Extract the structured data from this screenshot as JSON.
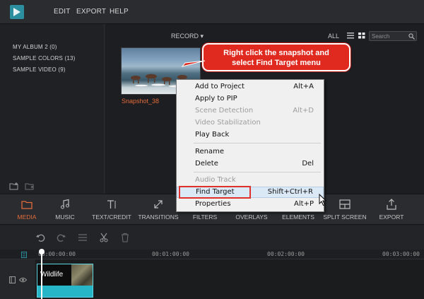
{
  "menu": {
    "items": [
      "EDIT",
      "EXPORT",
      "HELP"
    ]
  },
  "library": {
    "items": [
      "MY ALBUM 2 (0)",
      "SAMPLE COLORS (13)",
      "SAMPLE VIDEO (9)"
    ]
  },
  "media": {
    "record_label": "RECORD ▾",
    "all_label": "ALL",
    "search_placeholder": "Search",
    "thumbnail_label": "Snapshot_38"
  },
  "callout": {
    "line1": "Right click the snapshot and",
    "line2": "select Find Target menu"
  },
  "context_menu": {
    "items": [
      {
        "label": "Add to Project",
        "shortcut": "Alt+A",
        "disabled": false
      },
      {
        "label": "Apply to PIP",
        "shortcut": "",
        "disabled": false
      },
      {
        "label": "Scene Detection",
        "shortcut": "Alt+D",
        "disabled": true
      },
      {
        "label": "Video Stabilization",
        "shortcut": "",
        "disabled": true
      },
      {
        "label": "Play Back",
        "shortcut": "",
        "disabled": false
      },
      {
        "label": "Rename",
        "shortcut": "",
        "disabled": false
      },
      {
        "label": "Delete",
        "shortcut": "Del",
        "disabled": false
      },
      {
        "label": "Audio Track",
        "shortcut": "",
        "disabled": true
      },
      {
        "label": "Find Target",
        "shortcut": "Shift+Ctrl+R",
        "disabled": false
      },
      {
        "label": "Properties",
        "shortcut": "Alt+P",
        "disabled": false
      }
    ]
  },
  "toolbar": {
    "tabs": [
      "MEDIA",
      "MUSIC",
      "TEXT/CREDIT",
      "TRANSITIONS",
      "FILTERS",
      "OVERLAYS",
      "ELEMENTS",
      "SPLIT SCREEN",
      "EXPORT"
    ],
    "active": "MEDIA"
  },
  "timeline": {
    "times": [
      "00:00:00:00",
      "00:01:00:00",
      "00:02:00:00",
      "00:03:00:00"
    ],
    "clip_label": "Wildlife"
  },
  "colors": {
    "accent": "#e46b3a",
    "clip": "#27b6c8",
    "callout": "#e02a20"
  }
}
